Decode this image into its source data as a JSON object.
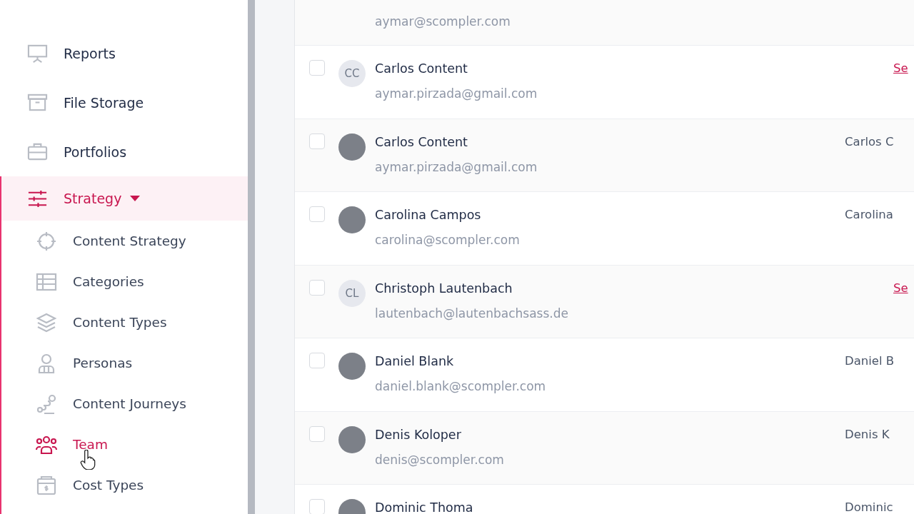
{
  "sidebar": {
    "items": [
      {
        "label": "Reports",
        "selected": false
      },
      {
        "label": "File Storage",
        "selected": false
      },
      {
        "label": "Portfolios",
        "selected": false
      },
      {
        "label": "Strategy",
        "selected": true,
        "expanded": true,
        "children": [
          {
            "label": "Content Strategy",
            "selected": false
          },
          {
            "label": "Categories",
            "selected": false
          },
          {
            "label": "Content Types",
            "selected": false
          },
          {
            "label": "Personas",
            "selected": false
          },
          {
            "label": "Content Journeys",
            "selected": false
          },
          {
            "label": "Team",
            "selected": true
          },
          {
            "label": "Cost Types",
            "selected": false
          }
        ]
      }
    ]
  },
  "members": [
    {
      "email": "aymar@scompler.com"
    },
    {
      "name": "Carlos Content",
      "email": "aymar.pirzada@gmail.com",
      "kind": "initials",
      "initials": "CC",
      "checked": false,
      "column_3": {
        "kind": "link",
        "text": "Se"
      }
    },
    {
      "name": "Carlos Content",
      "email": "aymar.pirzada@gmail.com",
      "kind": "photo",
      "checked": false,
      "column_3": {
        "kind": "text",
        "text": "Carlos C"
      }
    },
    {
      "name": "Carolina Campos",
      "email": "carolina@scompler.com",
      "kind": "photo",
      "checked": false,
      "column_3": {
        "kind": "text",
        "text": "Carolina"
      }
    },
    {
      "name": "Christoph Lautenbach",
      "email": "lautenbach@lautenbachsass.de",
      "kind": "initials",
      "initials": "CL",
      "checked": false,
      "column_3": {
        "kind": "link",
        "text": "Se"
      }
    },
    {
      "name": "Daniel Blank",
      "email": "daniel.blank@scompler.com",
      "kind": "photo",
      "checked": false,
      "column_3": {
        "kind": "text",
        "text": "Daniel B"
      }
    },
    {
      "name": "Denis Koloper",
      "email": "denis@scompler.com",
      "kind": "photo",
      "checked": false,
      "column_3": {
        "kind": "text",
        "text": "Denis K"
      }
    },
    {
      "name": "Dominic Thoma",
      "kind": "photo",
      "checked": false,
      "column_3": {
        "kind": "text",
        "text": "Dominic"
      }
    }
  ]
}
